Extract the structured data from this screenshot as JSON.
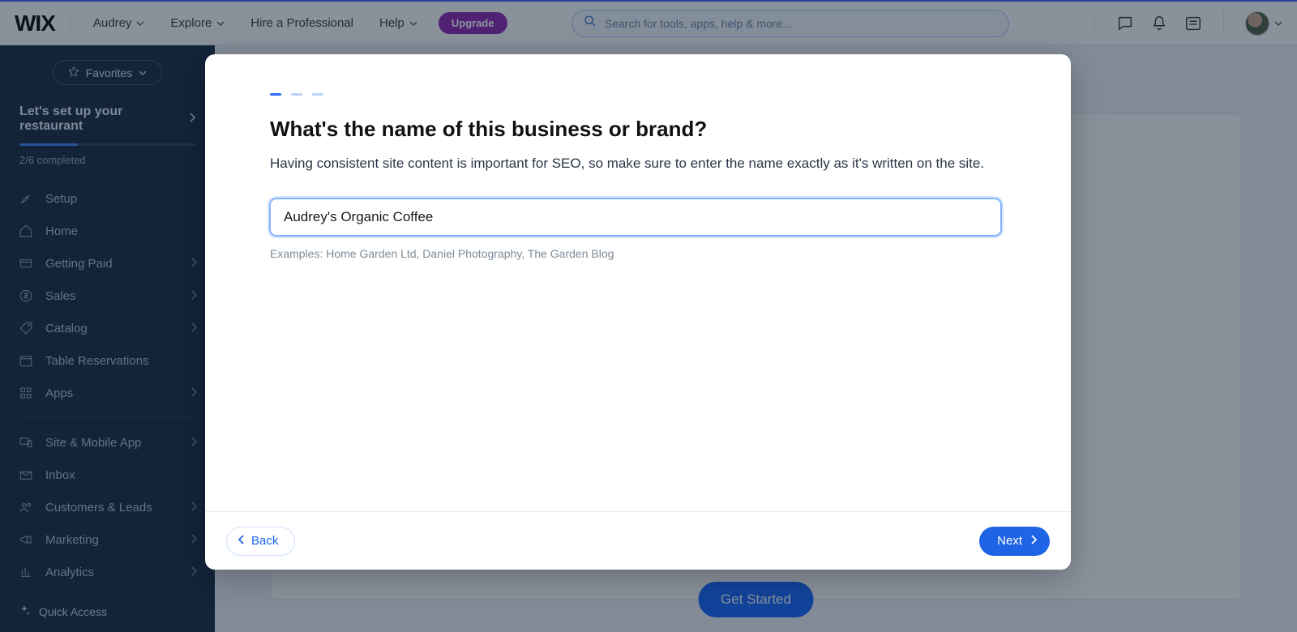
{
  "topbar": {
    "logo_text": "WIX",
    "user_name": "Audrey",
    "nav": {
      "explore": "Explore",
      "hire": "Hire a Professional",
      "help": "Help"
    },
    "upgrade_label": "Upgrade",
    "search_placeholder": "Search for tools, apps, help & more..."
  },
  "sidebar": {
    "favorites_label": "Favorites",
    "setup_title": "Let's set up your restaurant",
    "setup_count": "2/6 completed",
    "items": [
      {
        "label": "Setup",
        "chev": false
      },
      {
        "label": "Home",
        "chev": false
      },
      {
        "label": "Getting Paid",
        "chev": true
      },
      {
        "label": "Sales",
        "chev": true
      },
      {
        "label": "Catalog",
        "chev": true
      },
      {
        "label": "Table Reservations",
        "chev": false
      },
      {
        "label": "Apps",
        "chev": true
      }
    ],
    "items2": [
      {
        "label": "Site & Mobile App",
        "chev": true
      },
      {
        "label": "Inbox",
        "chev": false
      },
      {
        "label": "Customers & Leads",
        "chev": true
      },
      {
        "label": "Marketing",
        "chev": true
      },
      {
        "label": "Analytics",
        "chev": true
      }
    ],
    "quick_access": "Quick Access"
  },
  "main": {
    "get_started_label": "Get Started"
  },
  "modal": {
    "title": "What's the name of this business or brand?",
    "subtitle": "Having consistent site content is important for SEO, so make sure to enter the name exactly as it's written on the site.",
    "input_value": "Audrey's Organic Coffee",
    "examples": "Examples: Home Garden Ltd, Daniel Photography, The Garden Blog",
    "back_label": "Back",
    "next_label": "Next"
  }
}
